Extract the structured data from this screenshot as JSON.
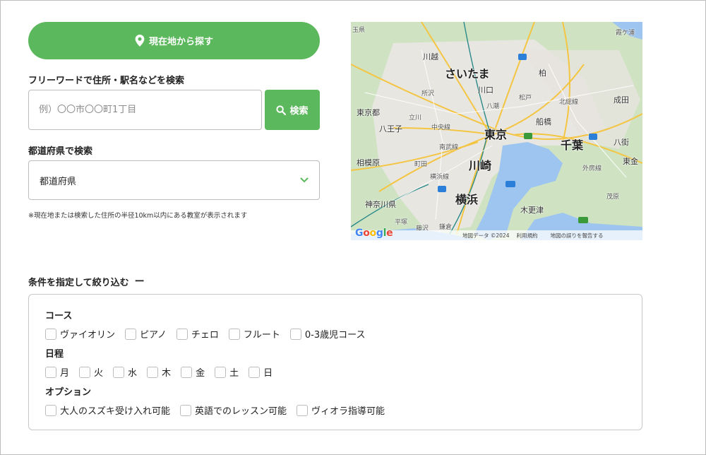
{
  "location_button": {
    "label": "現在地から探す",
    "icon": "map-pin-icon"
  },
  "free_word": {
    "label": "フリーワードで住所・駅名などを検索",
    "placeholder": "例）〇〇市〇〇町1丁目",
    "button_label": "検索",
    "button_icon": "search-icon"
  },
  "prefecture": {
    "label": "都道府県で検索",
    "selected": "都道府県",
    "icon": "chevron-down-icon"
  },
  "note": "※現在地または検索した住所の半径10km以内にある教室が表示されます",
  "map": {
    "labels_big": [
      "さいたま",
      "東京",
      "千葉",
      "川崎",
      "横浜"
    ],
    "labels_mid": [
      "川越",
      "川口",
      "柏",
      "船橋",
      "八王子",
      "東京都",
      "相模原",
      "神奈川県",
      "木更津",
      "八街",
      "東金",
      "成田"
    ],
    "labels_small": [
      "玉県",
      "所沢",
      "立川",
      "中央線",
      "南武線",
      "町田",
      "横浜線",
      "平塚",
      "藤沢",
      "鎌倉",
      "松戸",
      "北総線",
      "外房線",
      "茂原",
      "八潮",
      "霞ケ浦"
    ],
    "attribution": "地図データ ©2024",
    "terms": "利用規約",
    "report": "地図の誤りを報告する",
    "logo": [
      "G",
      "o",
      "o",
      "g",
      "l",
      "e"
    ],
    "colors": {
      "land": "#cfe3c3",
      "urban": "#e8e6e1",
      "water": "#9ec5ef",
      "highway": "#f4c542",
      "road": "#ffffff"
    }
  },
  "filter": {
    "title": "条件を指定して絞り込む",
    "toggle": "ー",
    "groups": [
      {
        "title": "コース",
        "options": [
          "ヴァイオリン",
          "ピアノ",
          "チェロ",
          "フルート",
          "0-3歳児コース"
        ]
      },
      {
        "title": "日程",
        "options": [
          "月",
          "火",
          "水",
          "木",
          "金",
          "土",
          "日"
        ]
      },
      {
        "title": "オプション",
        "options": [
          "大人のスズキ受け入れ可能",
          "英語でのレッスン可能",
          "ヴィオラ指導可能"
        ]
      }
    ]
  },
  "colors": {
    "accent": "#5cb85c",
    "border": "#bdbdbd"
  }
}
